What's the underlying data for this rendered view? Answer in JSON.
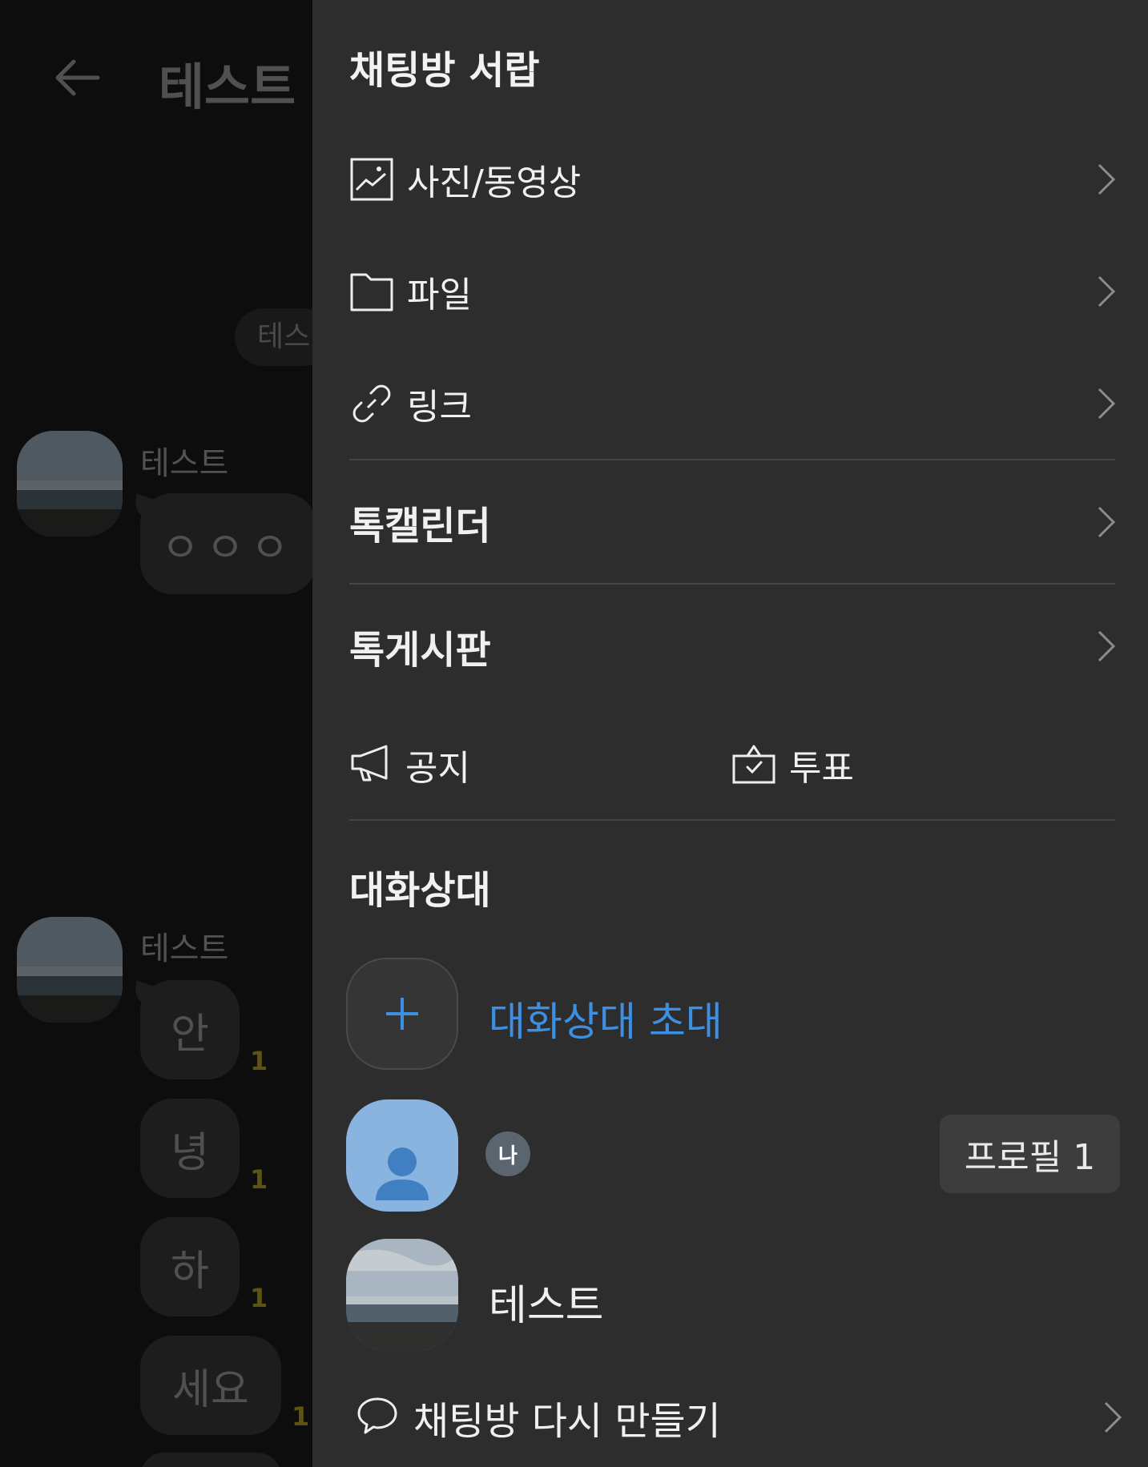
{
  "background_chat": {
    "title": "테스트 :",
    "date_chip": "테스",
    "messages": [
      {
        "sender": "테스트",
        "text": "ㅇㅇㅇ"
      },
      {
        "sender": "테스트",
        "texts": [
          "안",
          "녕",
          "하",
          "세요"
        ],
        "unread": "1"
      }
    ]
  },
  "drawer": {
    "title": "채팅방 서랍",
    "items": [
      {
        "label": "사진/동영상",
        "icon": "image-icon"
      },
      {
        "label": "파일",
        "icon": "folder-icon"
      },
      {
        "label": "링크",
        "icon": "link-icon"
      }
    ],
    "calendar": "톡캘린더",
    "board": "톡게시판",
    "notice": "공지",
    "vote": "투표",
    "members_title": "대화상대",
    "invite": "대화상대 초대",
    "me_badge": "나",
    "profile_chip": "프로필 1",
    "member_name": "테스트",
    "recreate": "채팅방 다시 만들기"
  },
  "colors": {
    "drawer_bg": "#2d2d2e",
    "accent": "#3d8fe3",
    "unread": "#a38f1e",
    "my_avatar": "#8ab4e0"
  }
}
